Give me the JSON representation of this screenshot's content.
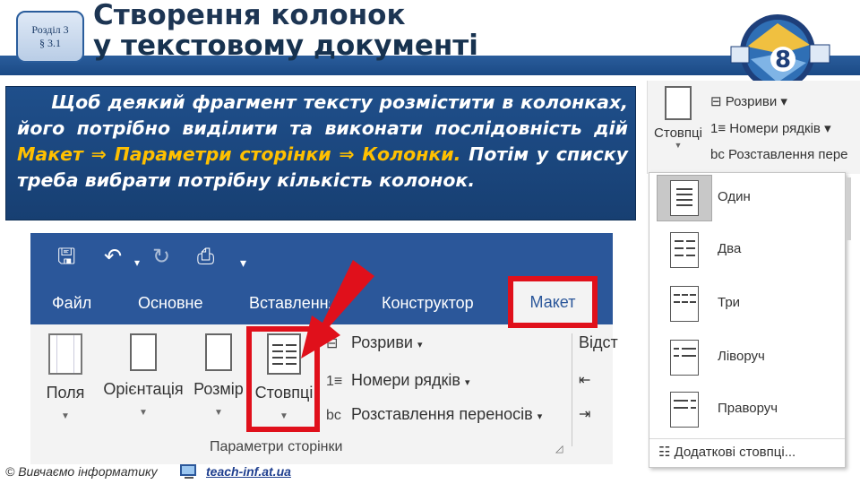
{
  "header": {
    "section_line1": "Розділ 3",
    "section_line2": "§ 3.1",
    "title_line1": "Створення колонок",
    "title_line2": "у текстовому документі",
    "grade": "8"
  },
  "info": {
    "part1": "Щоб деякий фрагмент тексту розмістити в колонках, його потрібно виділити та виконати послідовність дій ",
    "maket": "Макет",
    "arrow": " ⇒ ",
    "page_params": "Параметри сторінки",
    "arrow2": " ⇒ ",
    "columns": "Колонки.",
    "part2": " Потім у списку треба вибрати потрібну кількість колонок."
  },
  "ribbon": {
    "tabs": [
      "Файл",
      "Основне",
      "Вставлення",
      "Конструктор"
    ],
    "tab_active": "Макет",
    "buttons": {
      "fields": "Поля",
      "orientation": "Орієнтація",
      "size": "Розмір",
      "columns": "Стовпці"
    },
    "breaks": "Розриви",
    "line_numbers": "Номери рядків",
    "hyphenation": "Розставлення переносів",
    "group_label": "Параметри сторінки",
    "right_cut": "Відст"
  },
  "dropdown_panel": {
    "columns_label": "Стовпці",
    "breaks": "Розриви",
    "line_numbers": "Номери рядків",
    "hyphenation": "Розставлення пере",
    "items": [
      "Один",
      "Два",
      "Три",
      "Ліворуч",
      "Праворуч"
    ],
    "more": "Додаткові стовпці..."
  },
  "footer": {
    "copyright": "© Вивчаємо інформатику",
    "site": "teach-inf.at.ua"
  },
  "colors": {
    "ribbon_blue": "#2b579a",
    "highlight_red": "#e0101b",
    "info_bg": "#1f4f8b",
    "accent_yellow": "#ffc000"
  },
  "icons": [
    "save-icon",
    "undo-icon",
    "redo-icon",
    "print-preview-icon",
    "customize-qat-icon"
  ]
}
